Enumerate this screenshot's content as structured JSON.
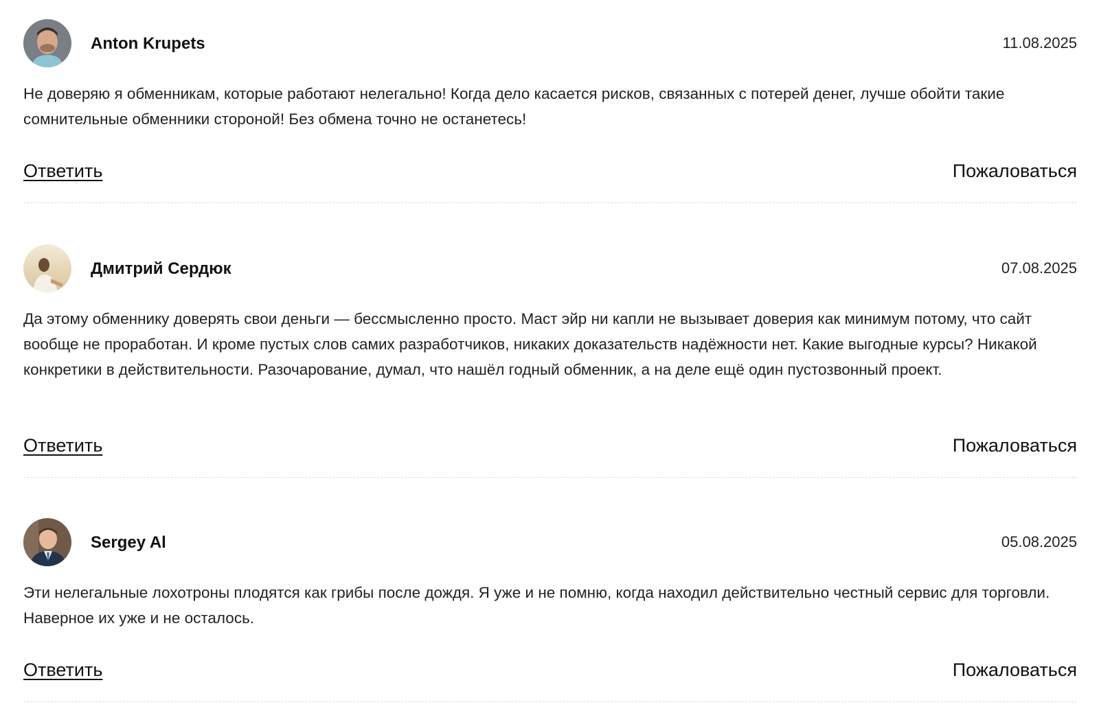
{
  "comments": [
    {
      "author": "Anton Krupets",
      "date": "11.08.2025",
      "text": "Не доверяю я обменникам, которые работают нелегально! Когда дело касается рисков, связанных с потерей денег, лучше обойти такие сомнительные обменники стороной! Без обмена точно не останетесь!",
      "reply_label": "Ответить",
      "report_label": "Пожаловаться",
      "avatar_icon": "user-photo-avatar"
    },
    {
      "author": "Дмитрий Сердюк",
      "date": "07.08.2025",
      "text": "Да этому обменнику доверять свои деньги — бессмысленно просто. Маст эйр ни капли не вызывает доверия как минимум потому, что сайт вообще не проработан. И кроме пустых слов самих разработчиков, никаких доказательств надёжности нет. Какие выгодные курсы? Никакой конкретики в действительности. Разочарование, думал, что нашёл годный обменник, а на деле ещё один пустозвонный проект.",
      "reply_label": "Ответить",
      "report_label": "Пожаловаться",
      "avatar_icon": "user-photo-avatar"
    },
    {
      "author": "Sergey Al",
      "date": "05.08.2025",
      "text": "Эти нелегальные лохотроны плодятся как грибы после дождя. Я уже и не помню, когда находил действительно честный сервис для торговли. Наверное их уже и не осталось.",
      "reply_label": "Ответить",
      "report_label": "Пожаловаться",
      "avatar_icon": "user-photo-avatar"
    }
  ]
}
